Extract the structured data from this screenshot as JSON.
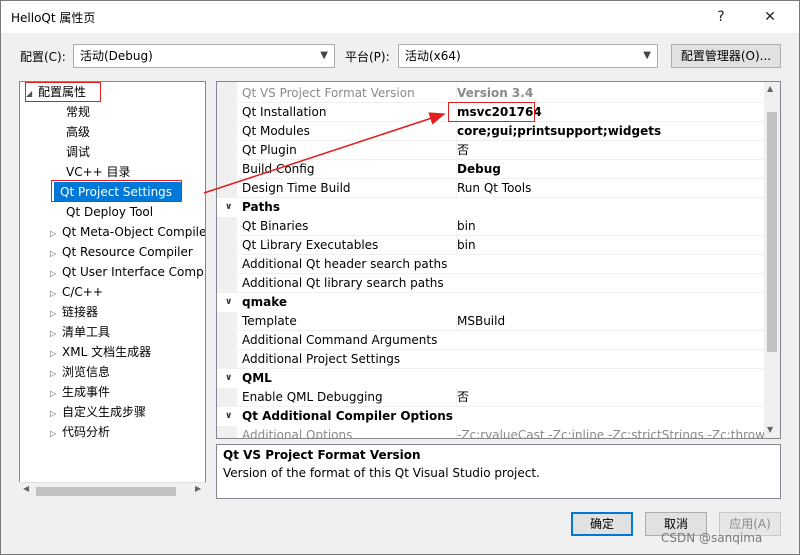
{
  "window": {
    "title": "HelloQt 属性页",
    "help": "?",
    "close": "✕"
  },
  "config": {
    "label": "配置(C):",
    "value": "活动(Debug)",
    "platform_label": "平台(P):",
    "platform_value": "活动(x64)",
    "manager_button": "配置管理器(O)..."
  },
  "tree": {
    "root": "配置属性",
    "items": [
      "常规",
      "高级",
      "调试",
      "VC++ 目录",
      "Qt Project Settings",
      "Qt Deploy Tool",
      "Qt Meta-Object Compile",
      "Qt Resource Compiler",
      "Qt User Interface Comp",
      "C/C++",
      "链接器",
      "清单工具",
      "XML 文档生成器",
      "浏览信息",
      "生成事件",
      "自定义生成步骤",
      "代码分析"
    ]
  },
  "grid": {
    "rows": [
      {
        "name": "Qt VS Project Format Version",
        "value": "Version 3.4"
      },
      {
        "name": "Qt Installation",
        "value": "msvc201764"
      },
      {
        "name": "Qt Modules",
        "value": "core;gui;printsupport;widgets"
      },
      {
        "name": "Qt Plugin",
        "value": "否"
      },
      {
        "name": "Build Config",
        "value": "Debug"
      },
      {
        "name": "Design Time Build",
        "value": "Run Qt Tools"
      }
    ],
    "paths_title": "Paths",
    "paths": [
      {
        "name": "Qt Binaries",
        "value": "bin"
      },
      {
        "name": "Qt Library Executables",
        "value": "bin"
      },
      {
        "name": "Additional Qt header search paths",
        "value": ""
      },
      {
        "name": "Additional Qt library search paths",
        "value": ""
      }
    ],
    "qmake_title": "qmake",
    "qmake": [
      {
        "name": "Template",
        "value": "MSBuild"
      },
      {
        "name": "Additional Command Arguments",
        "value": ""
      },
      {
        "name": "Additional Project Settings",
        "value": ""
      }
    ],
    "qml_title": "QML",
    "qml": [
      {
        "name": "Enable QML Debugging",
        "value": "否"
      }
    ],
    "compiler_title": "Qt Additional Compiler Options",
    "compiler": [
      {
        "name": "Additional Options",
        "value": "-Zc:rvalueCast -Zc:inline -Zc:strictStrings -Zc:throwingNew"
      }
    ]
  },
  "description": {
    "title": "Qt VS Project Format Version",
    "text": "Version of the format of this Qt Visual Studio project."
  },
  "buttons": {
    "ok": "确定",
    "cancel": "取消",
    "apply": "应用(A)"
  },
  "watermark": "CSDN @sanqima",
  "colors": {
    "selection": "#0078d7",
    "annotation_red": "#e02020"
  }
}
